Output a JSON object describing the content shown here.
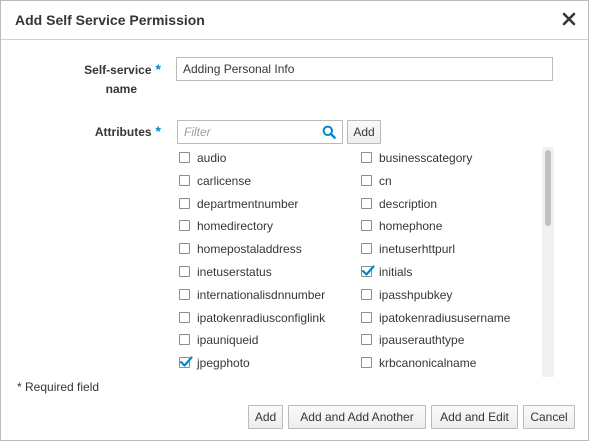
{
  "dialog": {
    "title": "Add Self Service Permission"
  },
  "form": {
    "name_label": "Self-service",
    "name_label_line2": "name",
    "name_value": "Adding Personal Info",
    "attributes_label": "Attributes",
    "required_marker": "*",
    "filter_placeholder": "Filter",
    "add_attr_label": "Add"
  },
  "attributes": {
    "left": [
      {
        "name": "audio",
        "checked": false
      },
      {
        "name": "carlicense",
        "checked": false
      },
      {
        "name": "departmentnumber",
        "checked": false
      },
      {
        "name": "homedirectory",
        "checked": false
      },
      {
        "name": "homepostaladdress",
        "checked": false
      },
      {
        "name": "inetuserstatus",
        "checked": false
      },
      {
        "name": "internationalisdnnumber",
        "checked": false
      },
      {
        "name": "ipatokenradiusconfiglink",
        "checked": false
      },
      {
        "name": "ipauniqueid",
        "checked": false
      },
      {
        "name": "jpegphoto",
        "checked": true
      }
    ],
    "right": [
      {
        "name": "businesscategory",
        "checked": false
      },
      {
        "name": "cn",
        "checked": false
      },
      {
        "name": "description",
        "checked": false
      },
      {
        "name": "homephone",
        "checked": false
      },
      {
        "name": "inetuserhttpurl",
        "checked": false
      },
      {
        "name": "initials",
        "checked": true
      },
      {
        "name": "ipasshpubkey",
        "checked": false
      },
      {
        "name": "ipatokenradiususername",
        "checked": false
      },
      {
        "name": "ipauserauthtype",
        "checked": false
      },
      {
        "name": "krbcanonicalname",
        "checked": false
      }
    ]
  },
  "footer": {
    "required_note": "* Required field",
    "buttons": {
      "add": "Add",
      "add_another": "Add and Add Another",
      "add_edit": "Add and Edit",
      "cancel": "Cancel"
    }
  },
  "colors": {
    "accent": "#0088ce",
    "text": "#363636",
    "border": "#bbbbbb"
  }
}
